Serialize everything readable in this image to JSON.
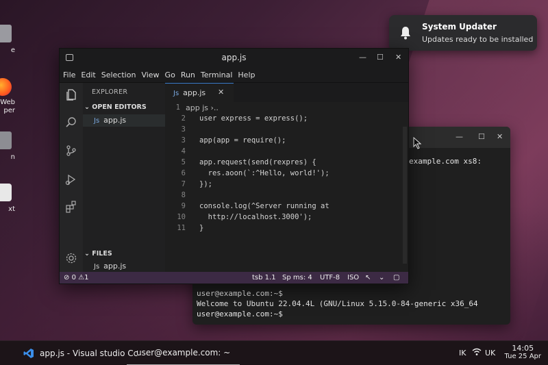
{
  "desktop": {
    "icons": [
      {
        "label": "e",
        "icon": "trash-icon"
      },
      {
        "label": "Web\nper",
        "icon": "firefox-icon"
      },
      {
        "label": "n",
        "icon": "files-icon"
      },
      {
        "label": "xt",
        "icon": "text-editor-icon"
      }
    ]
  },
  "notification": {
    "title": "System Updater",
    "body": "Updates ready to be installed",
    "icon": "bell-icon"
  },
  "terminal": {
    "top_text": "example.com xs8:",
    "lines": [
      "user@example.com:~$",
      "Welcome to Ubuntu 22.04.4L (GNU/Linux 5.15.0-84-generic x36_64",
      "user@example.com:~$"
    ]
  },
  "vscode": {
    "title": "app.js",
    "menu": [
      "File",
      "Edit",
      "Selection",
      "View",
      "Go",
      "Run",
      "Terminal",
      "Help"
    ],
    "sidebar": {
      "header": "EXPLORER",
      "open_editors_label": "OPEN EDITORS",
      "open_file": "app.js",
      "files_label": "FILES",
      "files_file": "app.js",
      "js_badge": "JS",
      "js_badge_small": "Js"
    },
    "tab": {
      "label": "app.js",
      "badge": "JS",
      "close": "✕"
    },
    "breadcrumb": "app js ›..",
    "code": [
      {
        "n": "1",
        "text": ""
      },
      {
        "n": "2",
        "text": "user express = express();"
      },
      {
        "n": "3",
        "text": ""
      },
      {
        "n": "3",
        "text": "app(app = require();"
      },
      {
        "n": "4",
        "text": ""
      },
      {
        "n": "5",
        "text": "app.request(send(rexpres) {"
      },
      {
        "n": "6",
        "text": "  res.aoon(`:^Hello, world!');"
      },
      {
        "n": "7",
        "text": "});"
      },
      {
        "n": "8",
        "text": ""
      },
      {
        "n": "9",
        "text": "console.log(^Server running at"
      },
      {
        "n": "10",
        "text": "  http://localhost.3000');"
      },
      {
        "n": "11",
        "text": "}"
      }
    ],
    "status": {
      "errors": "0",
      "warnings": "1",
      "position": "tsb 1.1",
      "spaces": "Sp ms: 4",
      "encoding": "UTF-8",
      "language": "ISO"
    }
  },
  "taskbar": {
    "vscode_task": "app.js - Visual studio Cc",
    "terminal_task": "user@example.com: ~",
    "keyboard": "IK",
    "layout": "UK",
    "time": "14:05",
    "date": "Tue 25 Apr"
  }
}
